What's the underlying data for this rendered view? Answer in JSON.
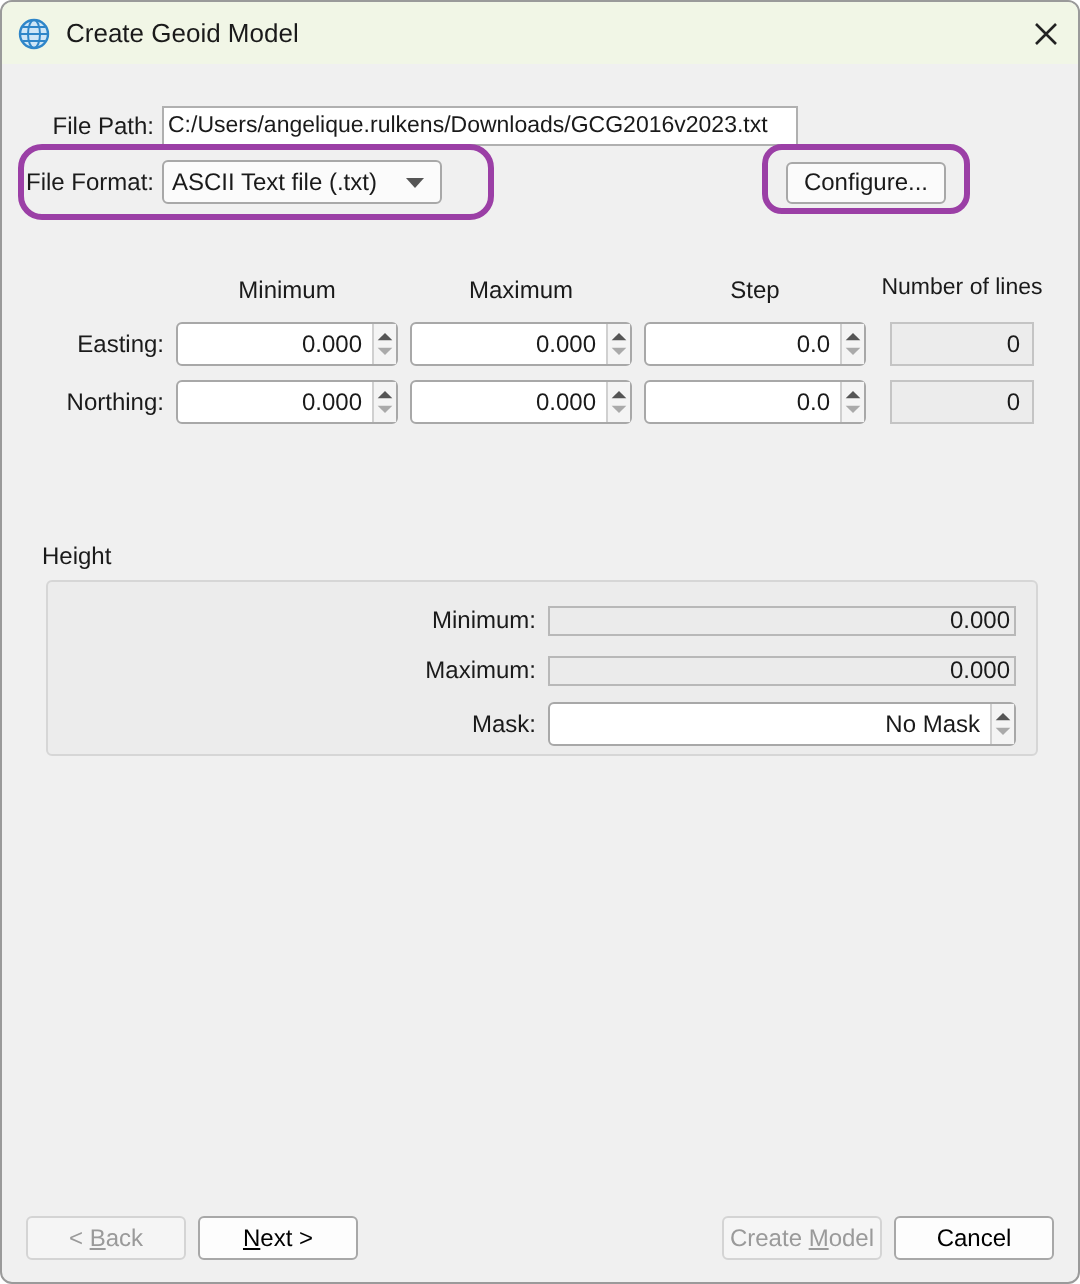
{
  "window": {
    "title": "Create Geoid Model"
  },
  "file_path": {
    "label": "File Path:",
    "value": "C:/Users/angelique.rulkens/Downloads/GCG2016v2023.txt"
  },
  "file_format": {
    "label": "File Format:",
    "value": "ASCII Text file (.txt)",
    "highlighted": true
  },
  "configure_button": {
    "label": "Configure...",
    "highlighted": true
  },
  "grid": {
    "columns": [
      "Minimum",
      "Maximum",
      "Step",
      "Number of lines"
    ],
    "rows": [
      {
        "label": "Easting:",
        "minimum": "0.000",
        "maximum": "0.000",
        "step": "0.0",
        "lines": "0"
      },
      {
        "label": "Northing:",
        "minimum": "0.000",
        "maximum": "0.000",
        "step": "0.0",
        "lines": "0"
      }
    ]
  },
  "height": {
    "title": "Height",
    "minimum_label": "Minimum:",
    "minimum": "0.000",
    "maximum_label": "Maximum:",
    "maximum": "0.000",
    "mask_label": "Mask:",
    "mask": "No Mask"
  },
  "buttons": [
    {
      "before": "< ",
      "underlined": "B",
      "after": "ack",
      "disabled": true
    },
    {
      "underlined": "N",
      "after": "ext >",
      "disabled": false
    },
    {
      "before": "Create ",
      "underlined": "M",
      "after": "odel",
      "disabled": true
    },
    {
      "before": "Cancel",
      "disabled": false
    }
  ]
}
